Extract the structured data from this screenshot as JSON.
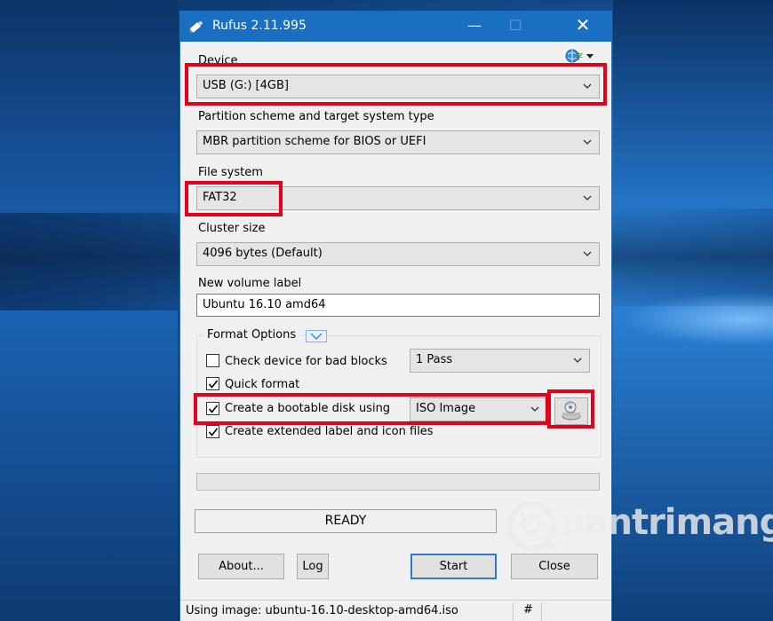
{
  "window": {
    "title": "Rufus 2.11.995",
    "controls": {
      "minimize": "—",
      "maximize": "☐",
      "close": "✕"
    }
  },
  "device": {
    "label": "Device",
    "value": "USB (G:) [4GB]"
  },
  "partition": {
    "label": "Partition scheme and target system type",
    "value": "MBR partition scheme for BIOS or UEFI"
  },
  "filesystem": {
    "label": "File system",
    "value": "FAT32"
  },
  "cluster": {
    "label": "Cluster size",
    "value": "4096 bytes (Default)"
  },
  "volume": {
    "label": "New volume label",
    "value": "Ubuntu 16.10 amd64"
  },
  "format_options": {
    "title": "Format Options",
    "bad_blocks": {
      "label": "Check device for bad blocks",
      "checked": false,
      "passes": "1 Pass"
    },
    "quick_format": {
      "label": "Quick format",
      "checked": true
    },
    "bootable": {
      "label": "Create a bootable disk using",
      "checked": true,
      "type": "ISO Image"
    },
    "extended_label": {
      "label": "Create extended label and icon files",
      "checked": true
    }
  },
  "progress": {
    "fraction": 0
  },
  "status": "READY",
  "buttons": {
    "about": "About...",
    "log": "Log",
    "start": "Start",
    "close": "Close"
  },
  "statusline": {
    "text": "Using image: ubuntu-16.10-desktop-amd64.iso",
    "hash": "#"
  },
  "watermark": {
    "text": "uantrimang"
  },
  "icons": {
    "app": "pen-drive-icon",
    "language": "globe-language-icon",
    "iso": "disc-drive-icon"
  },
  "colors": {
    "titlebar": "#1a6fc2",
    "annotation": "#e3001b",
    "default_button_border": "#2b7bd3"
  }
}
